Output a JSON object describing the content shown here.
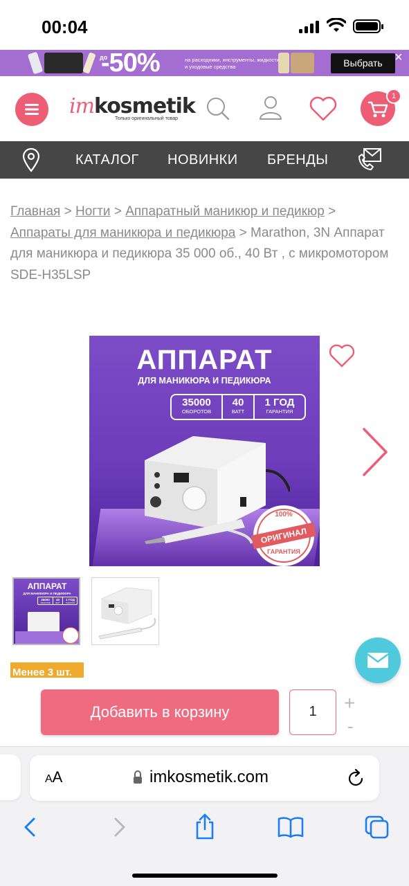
{
  "status_bar": {
    "time": "00:04"
  },
  "promo": {
    "prefix": "до",
    "discount": "-50%",
    "text": "на расходники, инструменты, жидкости и уходовые средства",
    "button_label": "Выбрать",
    "close_symbol": "×"
  },
  "header": {
    "logo_accent": "im",
    "logo_main": "kosmetik",
    "logo_tagline": "Только оригинальный товар",
    "cart_count": "1"
  },
  "nav": {
    "items": [
      "КАТАЛОГ",
      "НОВИНКИ",
      "БРЕНДЫ"
    ]
  },
  "breadcrumbs": {
    "links": [
      "Главная",
      "Ногти",
      "Аппаратный маникюр и педикюр",
      "Аппараты для маникюра и педикюра"
    ],
    "separator": ">",
    "current": "Marathon, 3N Аппарат для маникюра и педикюра 35 000 об., 40 Вт , с микромотором SDE-H35LSP"
  },
  "product_image": {
    "title": "АППАРАТ",
    "subtitle": "ДЛЯ МАНИКЮРА И ПЕДИКЮРА",
    "specs": [
      {
        "value": "35000",
        "label": "ОБОРОТОВ"
      },
      {
        "value": "40",
        "label": "ВАТТ"
      },
      {
        "value": "1 ГОД",
        "label": "ГАРАНТИЯ"
      }
    ],
    "stamp_top": "100%",
    "stamp_main": "ОРИГИНАЛ",
    "stamp_bottom": "ГАРАНТИЯ"
  },
  "thumbnails": {
    "first_title": "АППАРАТ",
    "first_subtitle": "ДЛЯ МАНИКЮРА И ПЕДИКЮРА",
    "first_specs": [
      {
        "value": "35000",
        "label": "ОБОРОТОВ"
      },
      {
        "value": "40",
        "label": "ВАТТ"
      },
      {
        "value": "1 ГОД",
        "label": "ГАРАНТИЯ"
      }
    ]
  },
  "stock": {
    "label": "Менее 3 шт."
  },
  "purchase": {
    "add_to_cart_label": "Добавить в корзину",
    "quantity": "1",
    "plus": "+",
    "minus": "-"
  },
  "browser": {
    "aa_small": "A",
    "aa_large": "A",
    "url": "imkosmetik.com"
  },
  "colors": {
    "accent": "#ee5d76",
    "nav_bg": "#464646",
    "promo_bg": "#a46dd2",
    "stock_badge": "#f0a92d",
    "mail_fab": "#4fcadd"
  }
}
